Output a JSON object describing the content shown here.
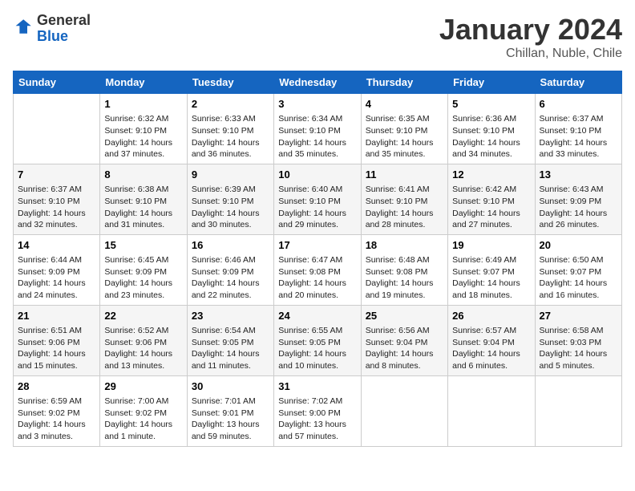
{
  "header": {
    "logo_line1": "General",
    "logo_line2": "Blue",
    "title": "January 2024",
    "subtitle": "Chillan, Nuble, Chile"
  },
  "weekdays": [
    "Sunday",
    "Monday",
    "Tuesday",
    "Wednesday",
    "Thursday",
    "Friday",
    "Saturday"
  ],
  "weeks": [
    [
      {
        "day": "",
        "sunrise": "",
        "sunset": "",
        "daylight": ""
      },
      {
        "day": "1",
        "sunrise": "Sunrise: 6:32 AM",
        "sunset": "Sunset: 9:10 PM",
        "daylight": "Daylight: 14 hours and 37 minutes."
      },
      {
        "day": "2",
        "sunrise": "Sunrise: 6:33 AM",
        "sunset": "Sunset: 9:10 PM",
        "daylight": "Daylight: 14 hours and 36 minutes."
      },
      {
        "day": "3",
        "sunrise": "Sunrise: 6:34 AM",
        "sunset": "Sunset: 9:10 PM",
        "daylight": "Daylight: 14 hours and 35 minutes."
      },
      {
        "day": "4",
        "sunrise": "Sunrise: 6:35 AM",
        "sunset": "Sunset: 9:10 PM",
        "daylight": "Daylight: 14 hours and 35 minutes."
      },
      {
        "day": "5",
        "sunrise": "Sunrise: 6:36 AM",
        "sunset": "Sunset: 9:10 PM",
        "daylight": "Daylight: 14 hours and 34 minutes."
      },
      {
        "day": "6",
        "sunrise": "Sunrise: 6:37 AM",
        "sunset": "Sunset: 9:10 PM",
        "daylight": "Daylight: 14 hours and 33 minutes."
      }
    ],
    [
      {
        "day": "7",
        "sunrise": "Sunrise: 6:37 AM",
        "sunset": "Sunset: 9:10 PM",
        "daylight": "Daylight: 14 hours and 32 minutes."
      },
      {
        "day": "8",
        "sunrise": "Sunrise: 6:38 AM",
        "sunset": "Sunset: 9:10 PM",
        "daylight": "Daylight: 14 hours and 31 minutes."
      },
      {
        "day": "9",
        "sunrise": "Sunrise: 6:39 AM",
        "sunset": "Sunset: 9:10 PM",
        "daylight": "Daylight: 14 hours and 30 minutes."
      },
      {
        "day": "10",
        "sunrise": "Sunrise: 6:40 AM",
        "sunset": "Sunset: 9:10 PM",
        "daylight": "Daylight: 14 hours and 29 minutes."
      },
      {
        "day": "11",
        "sunrise": "Sunrise: 6:41 AM",
        "sunset": "Sunset: 9:10 PM",
        "daylight": "Daylight: 14 hours and 28 minutes."
      },
      {
        "day": "12",
        "sunrise": "Sunrise: 6:42 AM",
        "sunset": "Sunset: 9:10 PM",
        "daylight": "Daylight: 14 hours and 27 minutes."
      },
      {
        "day": "13",
        "sunrise": "Sunrise: 6:43 AM",
        "sunset": "Sunset: 9:09 PM",
        "daylight": "Daylight: 14 hours and 26 minutes."
      }
    ],
    [
      {
        "day": "14",
        "sunrise": "Sunrise: 6:44 AM",
        "sunset": "Sunset: 9:09 PM",
        "daylight": "Daylight: 14 hours and 24 minutes."
      },
      {
        "day": "15",
        "sunrise": "Sunrise: 6:45 AM",
        "sunset": "Sunset: 9:09 PM",
        "daylight": "Daylight: 14 hours and 23 minutes."
      },
      {
        "day": "16",
        "sunrise": "Sunrise: 6:46 AM",
        "sunset": "Sunset: 9:09 PM",
        "daylight": "Daylight: 14 hours and 22 minutes."
      },
      {
        "day": "17",
        "sunrise": "Sunrise: 6:47 AM",
        "sunset": "Sunset: 9:08 PM",
        "daylight": "Daylight: 14 hours and 20 minutes."
      },
      {
        "day": "18",
        "sunrise": "Sunrise: 6:48 AM",
        "sunset": "Sunset: 9:08 PM",
        "daylight": "Daylight: 14 hours and 19 minutes."
      },
      {
        "day": "19",
        "sunrise": "Sunrise: 6:49 AM",
        "sunset": "Sunset: 9:07 PM",
        "daylight": "Daylight: 14 hours and 18 minutes."
      },
      {
        "day": "20",
        "sunrise": "Sunrise: 6:50 AM",
        "sunset": "Sunset: 9:07 PM",
        "daylight": "Daylight: 14 hours and 16 minutes."
      }
    ],
    [
      {
        "day": "21",
        "sunrise": "Sunrise: 6:51 AM",
        "sunset": "Sunset: 9:06 PM",
        "daylight": "Daylight: 14 hours and 15 minutes."
      },
      {
        "day": "22",
        "sunrise": "Sunrise: 6:52 AM",
        "sunset": "Sunset: 9:06 PM",
        "daylight": "Daylight: 14 hours and 13 minutes."
      },
      {
        "day": "23",
        "sunrise": "Sunrise: 6:54 AM",
        "sunset": "Sunset: 9:05 PM",
        "daylight": "Daylight: 14 hours and 11 minutes."
      },
      {
        "day": "24",
        "sunrise": "Sunrise: 6:55 AM",
        "sunset": "Sunset: 9:05 PM",
        "daylight": "Daylight: 14 hours and 10 minutes."
      },
      {
        "day": "25",
        "sunrise": "Sunrise: 6:56 AM",
        "sunset": "Sunset: 9:04 PM",
        "daylight": "Daylight: 14 hours and 8 minutes."
      },
      {
        "day": "26",
        "sunrise": "Sunrise: 6:57 AM",
        "sunset": "Sunset: 9:04 PM",
        "daylight": "Daylight: 14 hours and 6 minutes."
      },
      {
        "day": "27",
        "sunrise": "Sunrise: 6:58 AM",
        "sunset": "Sunset: 9:03 PM",
        "daylight": "Daylight: 14 hours and 5 minutes."
      }
    ],
    [
      {
        "day": "28",
        "sunrise": "Sunrise: 6:59 AM",
        "sunset": "Sunset: 9:02 PM",
        "daylight": "Daylight: 14 hours and 3 minutes."
      },
      {
        "day": "29",
        "sunrise": "Sunrise: 7:00 AM",
        "sunset": "Sunset: 9:02 PM",
        "daylight": "Daylight: 14 hours and 1 minute."
      },
      {
        "day": "30",
        "sunrise": "Sunrise: 7:01 AM",
        "sunset": "Sunset: 9:01 PM",
        "daylight": "Daylight: 13 hours and 59 minutes."
      },
      {
        "day": "31",
        "sunrise": "Sunrise: 7:02 AM",
        "sunset": "Sunset: 9:00 PM",
        "daylight": "Daylight: 13 hours and 57 minutes."
      },
      {
        "day": "",
        "sunrise": "",
        "sunset": "",
        "daylight": ""
      },
      {
        "day": "",
        "sunrise": "",
        "sunset": "",
        "daylight": ""
      },
      {
        "day": "",
        "sunrise": "",
        "sunset": "",
        "daylight": ""
      }
    ]
  ]
}
